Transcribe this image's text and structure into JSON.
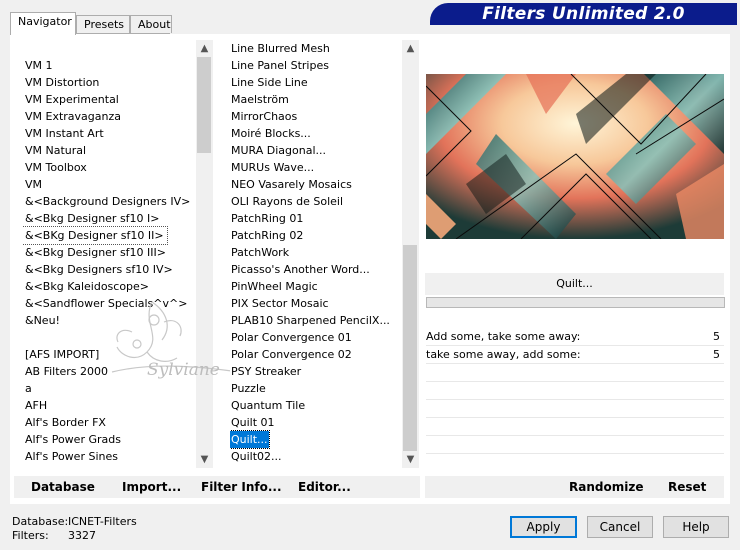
{
  "tabs": [
    "Navigator",
    "Presets",
    "About"
  ],
  "title": "Filters Unlimited 2.0",
  "categories": [
    "VM 1",
    "VM Distortion",
    "VM Experimental",
    "VM Extravaganza",
    "VM Instant Art",
    "VM Natural",
    "VM Toolbox",
    "VM",
    "&<Background Designers IV>",
    "&<Bkg Designer sf10 I>",
    "&<BKg Designer sf10 II>",
    "&<Bkg Designer sf10 III>",
    "&<Bkg Designers sf10 IV>",
    "&<Bkg Kaleidoscope>",
    "&<Sandflower Specials^v^>",
    "&Neu!",
    "",
    "[AFS IMPORT]",
    "AB Filters 2000",
    "a",
    "AFH",
    "Alf's Border FX",
    "Alf's Power Grads",
    "Alf's Power Sines"
  ],
  "categories_focus_index": 10,
  "filters": [
    "Line Blurred Mesh",
    "Line Panel Stripes",
    "Line Side Line",
    "Maelström",
    "MirrorChaos",
    "Moiré Blocks...",
    "MURA Diagonal...",
    "MURUs Wave...",
    "NEO Vasarely Mosaics",
    "OLI Rayons de Soleil",
    "PatchRing 01",
    "PatchRing 02",
    "PatchWork",
    "Picasso's Another Word...",
    "PinWheel Magic",
    "PIX Sector Mosaic",
    "PLAB10 Sharpened PencilX...",
    "Polar Convergence 01",
    "Polar Convergence 02",
    "PSY Streaker",
    "Puzzle",
    "Quantum Tile",
    "Quilt 01",
    "Quilt...",
    "Quilt02..."
  ],
  "filters_selected_index": 23,
  "watermark_text": "Sylviane",
  "filter_name_button": "Quilt...",
  "params": [
    {
      "label": "Add some, take some away:",
      "value": "5"
    },
    {
      "label": "take some away, add some:",
      "value": "5"
    }
  ],
  "buttons": {
    "database": "Database",
    "import": "Import...",
    "filter_info": "Filter Info...",
    "editor": "Editor...",
    "randomize": "Randomize",
    "reset": "Reset",
    "apply": "Apply",
    "cancel": "Cancel",
    "help": "Help"
  },
  "status": {
    "database_label": "Database:",
    "database_value": "ICNET-Filters",
    "filters_label": "Filters:",
    "filters_value": "3327"
  },
  "icons": [
    "scroll-up-arrow",
    "scroll-down-arrow"
  ],
  "colors": {
    "banner": "#0b1c8c",
    "selection": "#0078d7"
  }
}
